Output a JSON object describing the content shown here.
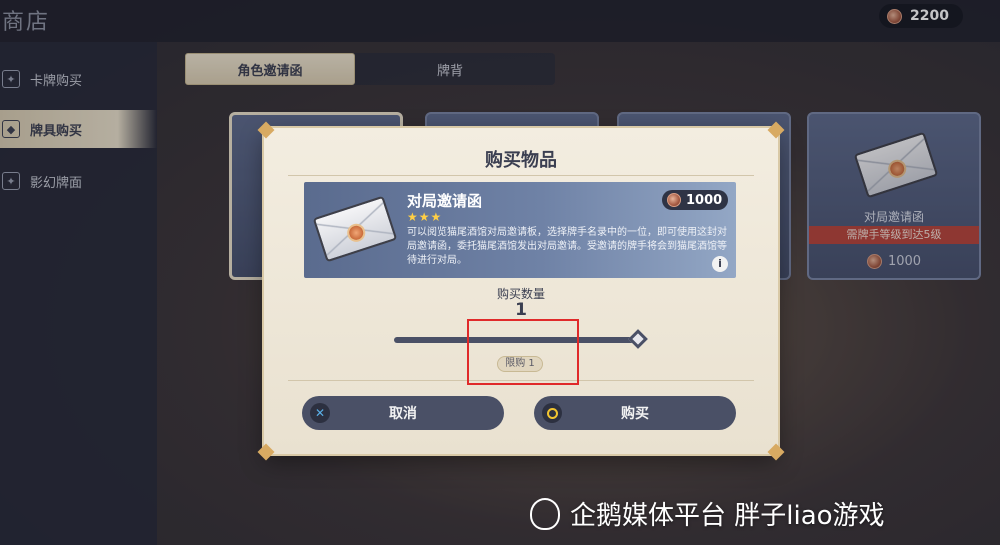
{
  "header": {
    "title": "商店",
    "currency": "2200"
  },
  "sidebar": {
    "items": [
      {
        "label": "卡牌购买",
        "active": false
      },
      {
        "label": "牌具购买",
        "active": true
      },
      {
        "label": "影幻牌面",
        "active": false
      }
    ]
  },
  "tabs": [
    {
      "label": "角色邀请函",
      "active": true
    },
    {
      "label": "牌背",
      "active": false
    }
  ],
  "right_card": {
    "name": "对局邀请函",
    "requirement": "需牌手等级到达5级",
    "price": "1000"
  },
  "modal": {
    "title": "购买物品",
    "item": {
      "name": "对局邀请函",
      "stars": "★★★",
      "price": "1000",
      "description": "可以阅览猫尾酒馆对局邀请板，选择牌手名录中的一位，即可使用这封对局邀请函，委托猫尾酒馆发出对局邀请。受邀请的牌手将会到猫尾酒馆等待进行对局。"
    },
    "quantity_label": "购买数量",
    "quantity": "1",
    "limit": "限购 1",
    "cancel_label": "取消",
    "buy_label": "购买"
  },
  "watermark": "企鹅媒体平台 胖子liao游戏",
  "colors": {
    "highlight": "#e02a2a",
    "accent": "#d8aa62"
  }
}
